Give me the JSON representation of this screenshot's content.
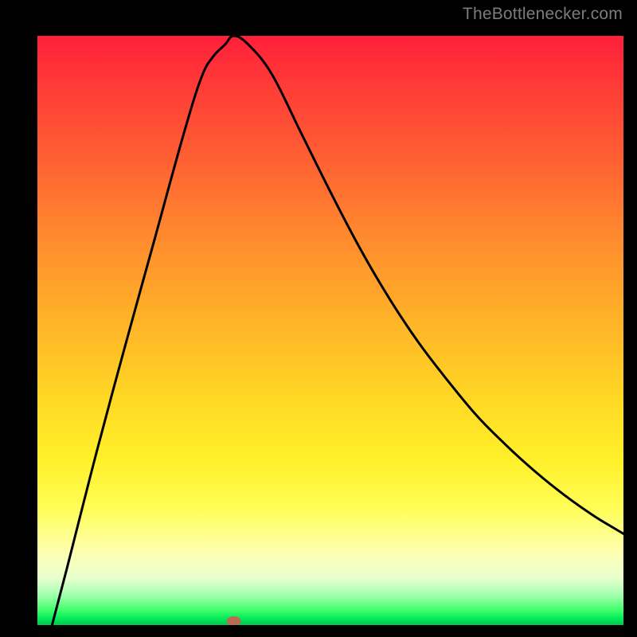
{
  "watermark": {
    "text": "TheBottlenecker.com"
  },
  "chart_data": {
    "type": "line",
    "title": "",
    "xlabel": "",
    "ylabel": "",
    "xlim_norm": [
      0,
      1
    ],
    "ylim_norm": [
      0,
      1
    ],
    "series": [
      {
        "name": "bottleneck-curve",
        "x_norm": [
          0.025,
          0.05,
          0.1,
          0.15,
          0.2,
          0.25,
          0.28,
          0.3,
          0.32,
          0.335,
          0.36,
          0.4,
          0.45,
          0.5,
          0.55,
          0.6,
          0.65,
          0.7,
          0.75,
          0.8,
          0.85,
          0.9,
          0.95,
          1.0
        ],
        "y_norm": [
          0.0,
          0.095,
          0.29,
          0.475,
          0.655,
          0.835,
          0.93,
          0.965,
          0.985,
          1.0,
          0.985,
          0.935,
          0.835,
          0.735,
          0.64,
          0.555,
          0.48,
          0.415,
          0.355,
          0.305,
          0.26,
          0.22,
          0.185,
          0.155
        ]
      }
    ],
    "min_marker": {
      "x_norm": 0.335,
      "y_norm": 1.0
    },
    "gradient_legend_top_to_bottom": [
      "#ff1f3a",
      "#ff8a2e",
      "#ffd924",
      "#fdffb4",
      "#00c94a"
    ]
  }
}
